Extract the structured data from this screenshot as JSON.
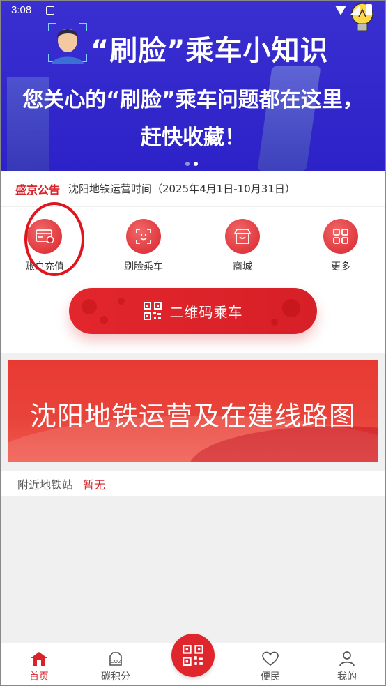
{
  "status_bar": {
    "time": "3:08",
    "icons": [
      "notification-icon",
      "wifi-icon",
      "signal-icon",
      "battery-icon"
    ]
  },
  "banner": {
    "title": "“刷脸”乘车小知识",
    "line2": "您关心的“刷脸”乘车问题都在这里，",
    "line3": "赶快收藏！",
    "page_count": 2,
    "active_page": 2
  },
  "notice": {
    "label": "盛京公告",
    "text": "沈阳地铁运营时间（2025年4月1日-10月31日）"
  },
  "quick_menu": {
    "items": [
      {
        "label": "账户充值",
        "icon": "card-recharge-icon"
      },
      {
        "label": "刷脸乘车",
        "icon": "face-scan-icon"
      },
      {
        "label": "商城",
        "icon": "shop-icon"
      },
      {
        "label": "更多",
        "icon": "grid-more-icon"
      }
    ]
  },
  "qr_button": {
    "label": "二维码乘车",
    "icon": "qr-code-icon"
  },
  "map_banner": {
    "title": "沈阳地铁运营及在建线路图"
  },
  "nearby": {
    "label": "附近地铁站",
    "value": "暂无"
  },
  "tab_bar": {
    "items": [
      {
        "label": "首页",
        "icon": "home-icon",
        "active": true
      },
      {
        "label": "碳积分",
        "icon": "co2-icon",
        "active": false
      },
      {
        "label": "",
        "icon": "qr-code-icon",
        "active": false
      },
      {
        "label": "便民",
        "icon": "heart-icon",
        "active": false
      },
      {
        "label": "我的",
        "icon": "person-icon",
        "active": false
      }
    ]
  },
  "colors": {
    "brand_red": "#d8232a",
    "banner_blue": "#2c22c8",
    "highlight_ring": "#e0141e"
  }
}
